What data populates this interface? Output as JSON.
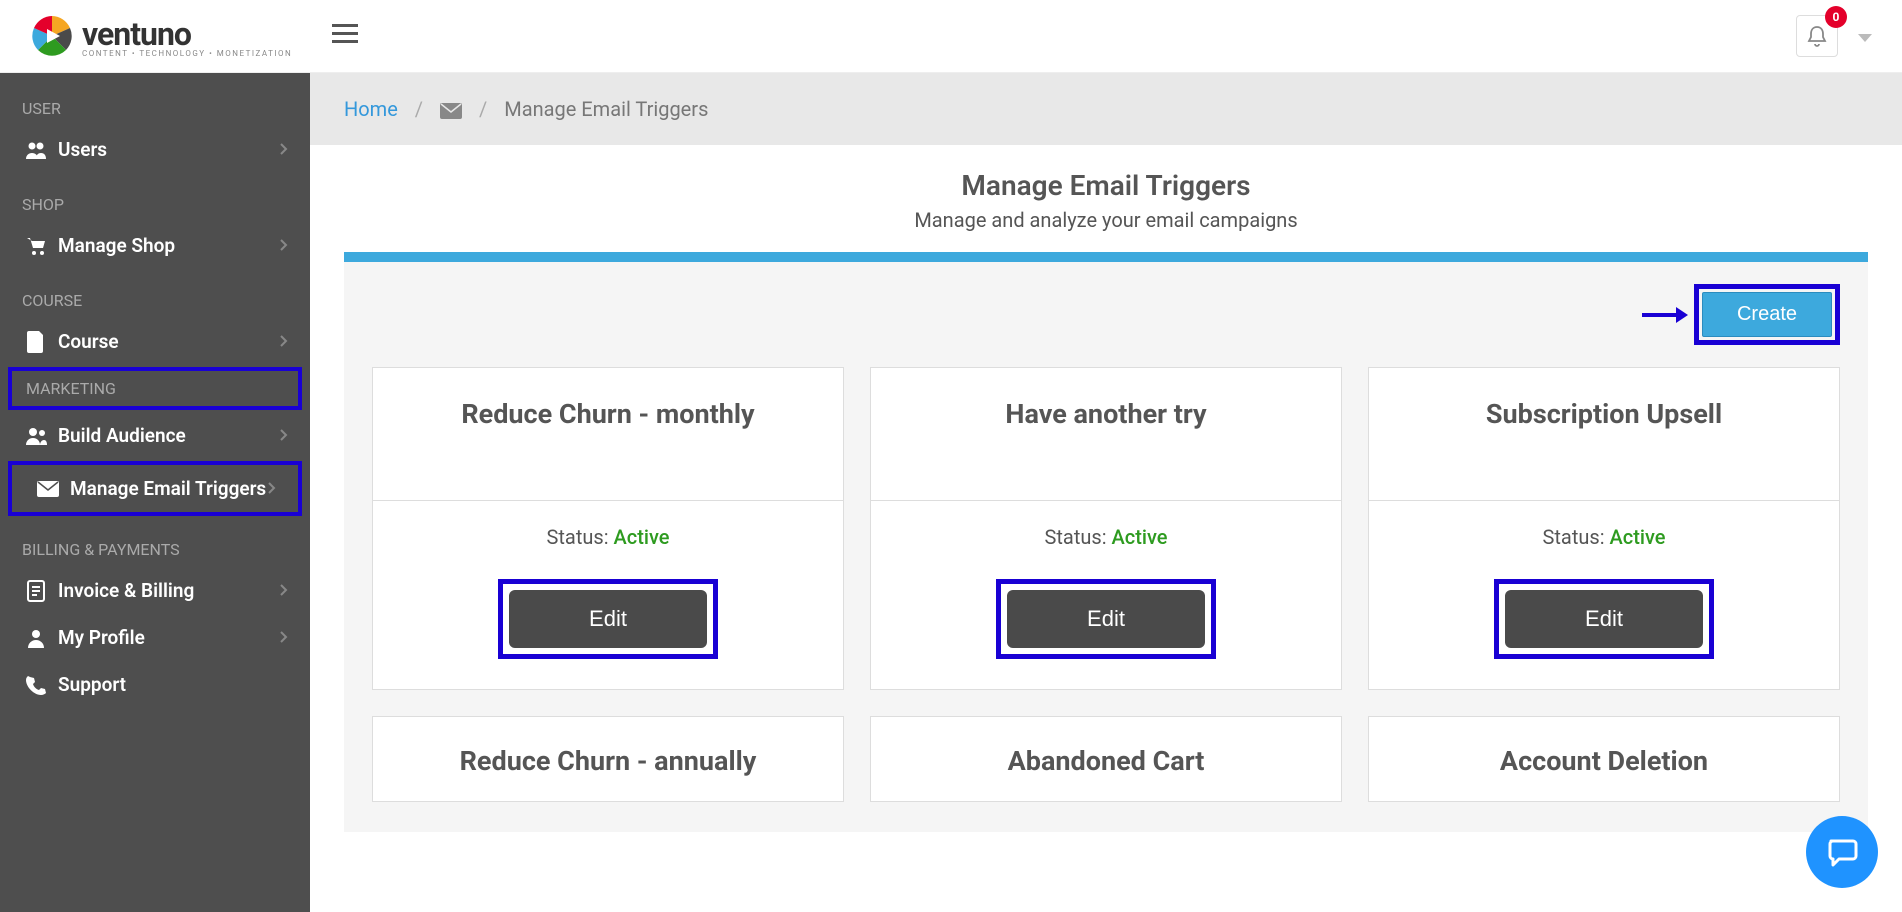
{
  "brand": {
    "name": "ventuno",
    "tagline": "CONTENT • TECHNOLOGY • MONETIZATION"
  },
  "header": {
    "notif_count": "0"
  },
  "sidebar": {
    "sections": [
      {
        "heading": "USER",
        "items": [
          {
            "icon": "users",
            "label": "Users"
          }
        ]
      },
      {
        "heading": "SHOP",
        "items": [
          {
            "icon": "cart",
            "label": "Manage Shop"
          }
        ]
      },
      {
        "heading": "COURSE",
        "items": [
          {
            "icon": "file",
            "label": "Course"
          }
        ]
      },
      {
        "heading": "MARKETING",
        "hl": true,
        "items": [
          {
            "icon": "people",
            "label": "Build Audience"
          },
          {
            "icon": "mail",
            "label": "Manage Email Triggers",
            "hl": true
          }
        ]
      },
      {
        "heading": "BILLING & PAYMENTS",
        "items": [
          {
            "icon": "doc",
            "label": "Invoice & Billing"
          },
          {
            "icon": "user",
            "label": "My Profile"
          },
          {
            "icon": "phone",
            "label": "Support",
            "no_chev": true
          }
        ]
      }
    ]
  },
  "breadcrumb": {
    "home": "Home",
    "current": "Manage Email Triggers"
  },
  "page": {
    "title": "Manage Email Triggers",
    "subtitle": "Manage and analyze your email campaigns",
    "create": "Create"
  },
  "status_label": "Status: ",
  "edit_label": "Edit",
  "cards_row1": [
    {
      "title": "Reduce Churn - monthly",
      "status": "Active"
    },
    {
      "title": "Have another try",
      "status": "Active"
    },
    {
      "title": "Subscription Upsell",
      "status": "Active"
    }
  ],
  "cards_row2": [
    {
      "title": "Reduce Churn - annually"
    },
    {
      "title": "Abandoned Cart"
    },
    {
      "title": "Account Deletion"
    }
  ]
}
